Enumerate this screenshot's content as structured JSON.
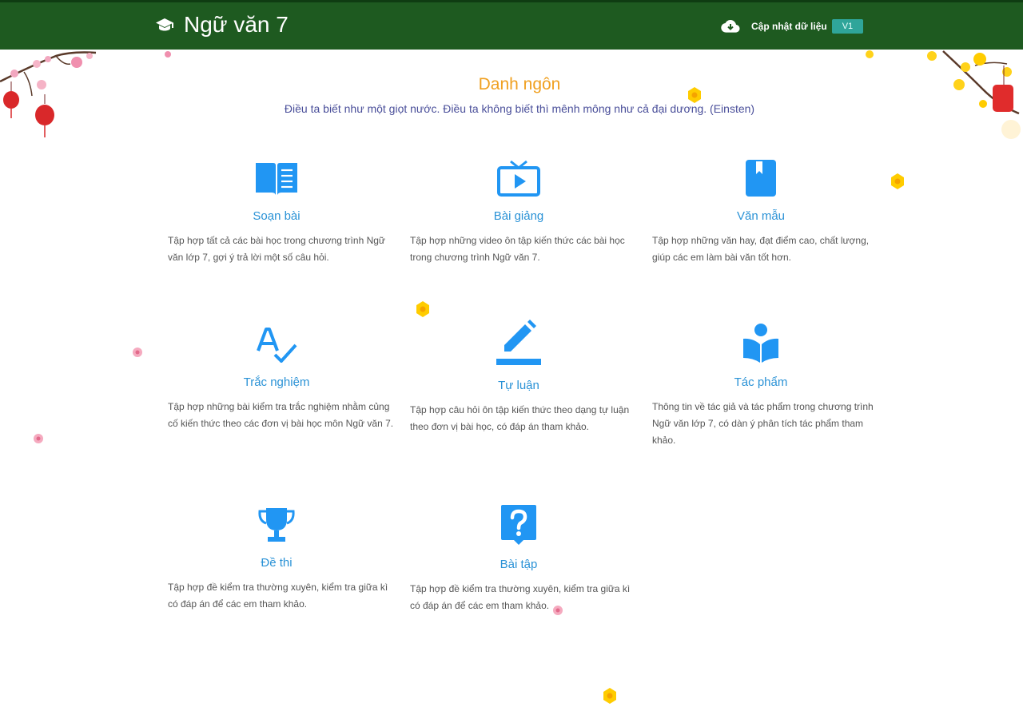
{
  "header": {
    "title": "Ngữ văn 7",
    "update_label": "Cập nhật dữ liệu",
    "version": "V1",
    "bg_color": "#1e5a20"
  },
  "quote": {
    "heading": "Danh ngôn",
    "text": "Điều ta biết như một giọt nước. Điều ta không biết thì mênh mông như cả đại dương. (Einsten)"
  },
  "cards": [
    {
      "title": "Soạn bài",
      "description": "Tập hợp tất cả các bài học trong chương trình Ngữ văn lớp 7, gợi ý trả lời một số câu hỏi.",
      "icon": "book-open-icon"
    },
    {
      "title": "Bài giảng",
      "description": "Tập hợp những video ôn tập kiến thức các bài học trong chương trình Ngữ văn 7.",
      "icon": "tv-play-icon"
    },
    {
      "title": "Văn mẫu",
      "description": "Tập hợp những văn hay, đạt điểm cao, chất lượng, giúp các em làm bài văn tốt hơn.",
      "icon": "bookmark-book-icon"
    },
    {
      "title": "Trắc nghiệm",
      "description": "Tập hợp những bài kiểm tra trắc nghiệm nhằm củng cố kiến thức theo các đơn vị bài học môn Ngữ văn 7.",
      "icon": "spellcheck-icon"
    },
    {
      "title": "Tự luận",
      "description": "Tập hợp câu hỏi ôn tập kiến thức theo dạng tự luận theo đơn vị bài học, có đáp án tham khảo.",
      "icon": "pencil-edit-icon"
    },
    {
      "title": "Tác phẩm",
      "description": "Thông tin về tác giả và tác phẩm trong chương trình Ngữ văn lớp 7, có dàn ý phân tích tác phẩm tham khảo.",
      "icon": "reader-book-icon"
    },
    {
      "title": "Đề thi",
      "description": "Tập hợp đề kiểm tra thường xuyên, kiểm tra giữa kì có đáp án để các em tham khảo.",
      "icon": "trophy-icon"
    },
    {
      "title": "Bài tập",
      "description": "Tập hợp đề kiểm tra thường xuyên, kiểm tra giữa kì có đáp án để các em tham khảo.",
      "icon": "question-help-icon"
    }
  ],
  "colors": {
    "accent_blue": "#2a92d6",
    "icon_blue": "#2196f3",
    "quote_heading": "#f0a020",
    "quote_text": "#4a4f9a"
  }
}
